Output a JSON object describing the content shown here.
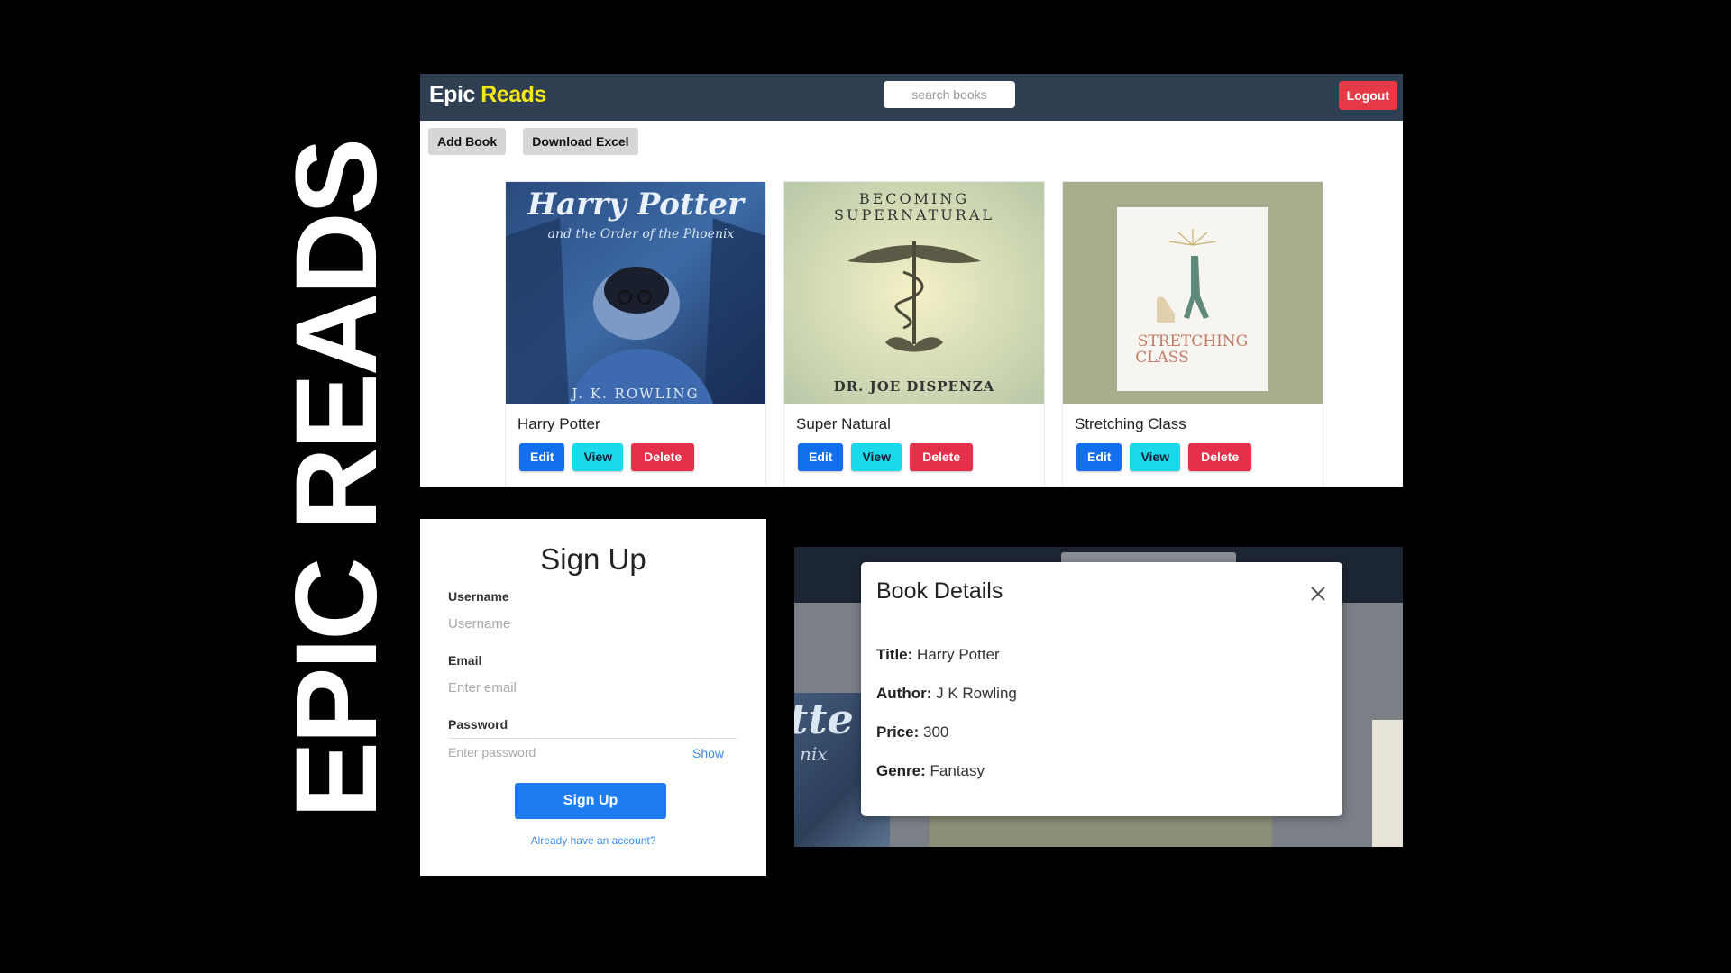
{
  "side_title": "EPIC READS",
  "colors": {
    "navbar": "#2f3f52",
    "brand_accent": "#f5e71c",
    "edit": "#1270ee",
    "view": "#19d9ea",
    "delete": "#e4304a",
    "logout": "#e63946",
    "primary": "#1c7cf0"
  },
  "navbar": {
    "brand_part1": "Epic",
    "brand_part2": "Reads",
    "search_placeholder": "search books",
    "logout_label": "Logout"
  },
  "toolbar": {
    "add_label": "Add Book",
    "download_label": "Download Excel"
  },
  "books": [
    {
      "title": "Harry Potter",
      "cover_text_1": "Harry Potter",
      "cover_text_2": "and the Order of the Phoenix",
      "cover_text_3": "J. K. ROWLING",
      "edit": "Edit",
      "view": "View",
      "delete": "Delete"
    },
    {
      "title": "Super Natural",
      "cover_text_1": "BECOMING",
      "cover_text_2": "SUPERNATURAL",
      "cover_text_3": "DR. JOE DISPENZA",
      "edit": "Edit",
      "view": "View",
      "delete": "Delete"
    },
    {
      "title": "Stretching Class",
      "cover_text_1": "STRETCHING",
      "cover_text_2": "CLASS",
      "edit": "Edit",
      "view": "View",
      "delete": "Delete"
    }
  ],
  "signup": {
    "title": "Sign Up",
    "username_label": "Username",
    "username_placeholder": "Username",
    "email_label": "Email",
    "email_placeholder": "Enter email",
    "password_label": "Password",
    "password_placeholder": "Enter password",
    "show_label": "Show",
    "submit_label": "Sign Up",
    "login_link": "Already have an account?"
  },
  "details": {
    "modal_title": "Book Details",
    "close_icon": "close-icon",
    "title_label": "Title:",
    "title_value": "Harry Potter",
    "author_label": "Author:",
    "author_value": "J K Rowling",
    "price_label": "Price:",
    "price_value": "300",
    "genre_label": "Genre:",
    "genre_value": "Fantasy",
    "background_cover_text": "tte",
    "background_cover_text_2": "nix"
  }
}
